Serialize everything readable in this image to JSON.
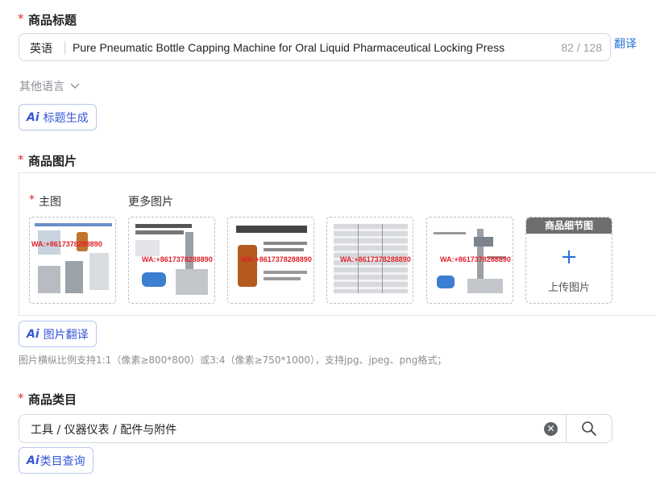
{
  "title_section": {
    "required_mark": "*",
    "label": "商品标题",
    "language": "英语",
    "title_value": "Pure Pneumatic Bottle Capping Machine for Oral Liquid Pharmaceutical Locking Press",
    "counter": "82 / 128",
    "translate_link": "翻译",
    "other_languages": "其他语言",
    "ai_button": {
      "ai": "Ai",
      "label": "标题生成"
    }
  },
  "image_section": {
    "required_mark": "*",
    "label": "商品图片",
    "main_required_mark": "*",
    "main_label": "主图",
    "more_label": "更多图片",
    "thumbnails": [
      {
        "watermark": "WA:+8617378288890"
      },
      {
        "watermark": "WA:+8617378288890"
      },
      {
        "watermark": "WA:+8617378288890"
      },
      {
        "watermark": "WA:+8617378288890"
      },
      {
        "watermark": "WA:+8617378288890"
      }
    ],
    "upload_header": "商品细节图",
    "upload_label": "上传图片",
    "ai_button": {
      "ai": "Ai",
      "label": "图片翻译"
    },
    "hint": "图片横纵比例支持1:1（像素≥800*800）或3:4（像素≥750*1000），支持jpg、jpeg、png格式；"
  },
  "category_section": {
    "required_mark": "*",
    "label": "商品类目",
    "value": "工具 / 仪器仪表 / 配件与附件",
    "ai_button": {
      "ai": "Ai",
      "label": "类目查询"
    }
  },
  "colors": {
    "accent": "#2a73d9",
    "ai_button": "#3457d5",
    "required": "#e02b2b"
  }
}
